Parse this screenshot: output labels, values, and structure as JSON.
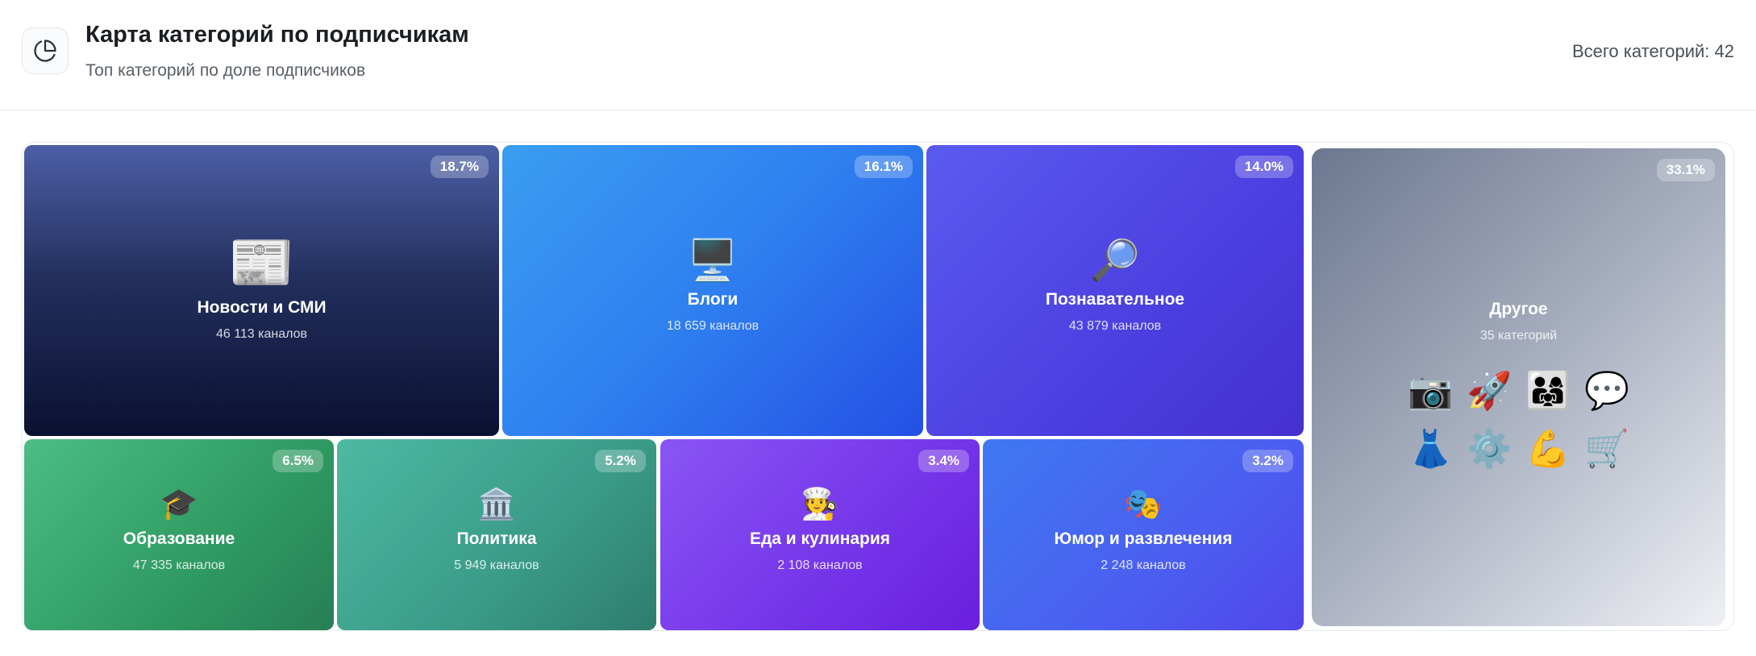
{
  "header": {
    "logo_icon": "pie-chart-icon",
    "title": "Карта категорий по подписчикам",
    "subtitle": "Топ категорий по доле подписчиков",
    "total": "Всего категорий: 42"
  },
  "tiles": {
    "news": {
      "pct": "18.7%",
      "emoji": "📰",
      "icon": "newspaper-icon",
      "name": "Новости и СМИ",
      "count": "46 113 каналов"
    },
    "blogs": {
      "pct": "16.1%",
      "emoji": "🖥️",
      "icon": "blog-window-icon",
      "name": "Блоги",
      "count": "18 659 каналов"
    },
    "cogn": {
      "pct": "14.0%",
      "emoji": "🔎",
      "icon": "magnifier-icon",
      "name": "Познавательное",
      "count": "43 879 каналов"
    },
    "edu": {
      "pct": "6.5%",
      "emoji": "🎓",
      "icon": "graduation-cap-icon",
      "name": "Образование",
      "count": "47 335 каналов"
    },
    "pol": {
      "pct": "5.2%",
      "emoji": "🏛️",
      "icon": "classical-building-icon",
      "name": "Политика",
      "count": "5 949 каналов"
    },
    "food": {
      "pct": "3.4%",
      "emoji": "🧑‍🍳",
      "icon": "cook-icon",
      "name": "Еда и кулинария",
      "count": "2 108 каналов"
    },
    "humor": {
      "pct": "3.2%",
      "emoji": "🎭",
      "icon": "theater-curtain-icon",
      "name": "Юмор и развлечения",
      "count": "2 248 каналов"
    }
  },
  "other": {
    "pct": "33.1%",
    "name": "Другое",
    "count": "35 категорий",
    "icons": [
      {
        "emoji": "📷",
        "icon": "camera-icon"
      },
      {
        "emoji": "🚀",
        "icon": "rocket-icon"
      },
      {
        "emoji": "👨‍👩‍👧",
        "icon": "family-icon"
      },
      {
        "emoji": "💬",
        "icon": "chat-bubble-icon"
      },
      {
        "emoji": "👗",
        "icon": "dress-icon"
      },
      {
        "emoji": "⚙️",
        "icon": "gear-icon"
      },
      {
        "emoji": "💪",
        "icon": "dumbbell-icon"
      },
      {
        "emoji": "🛒",
        "icon": "shopping-cart-icon"
      }
    ]
  }
}
